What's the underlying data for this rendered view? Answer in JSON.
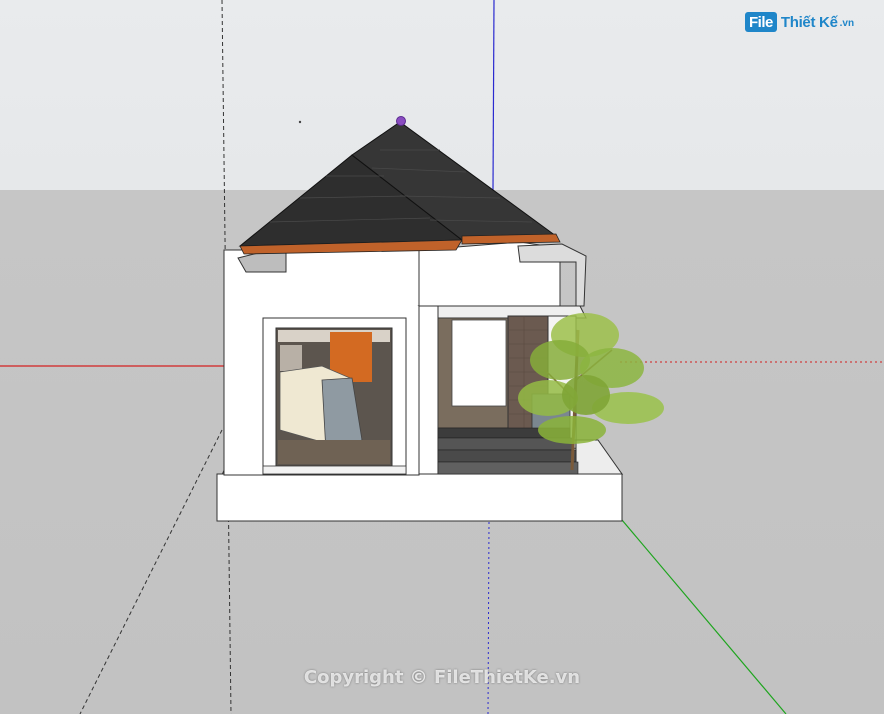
{
  "watermark": {
    "logo_badge": "File",
    "logo_name": "Thiết Kế",
    "logo_suffix": ".vn",
    "copyright": "Copyright © FileThietKe.vn"
  },
  "colors": {
    "sky": "#e8eaec",
    "ground": "#c4c4c4",
    "axis_red": "#d42020",
    "axis_green": "#1ea51e",
    "axis_blue": "#2a2ad0",
    "roof": "#2e2e2e",
    "fascia": "#c0622a",
    "wall": "#ffffff",
    "stone": "#6b5a50",
    "foliage": "#8bb43a"
  },
  "icons": {
    "model_origin": "purple-vertex-marker",
    "tree": "tree-icon"
  }
}
